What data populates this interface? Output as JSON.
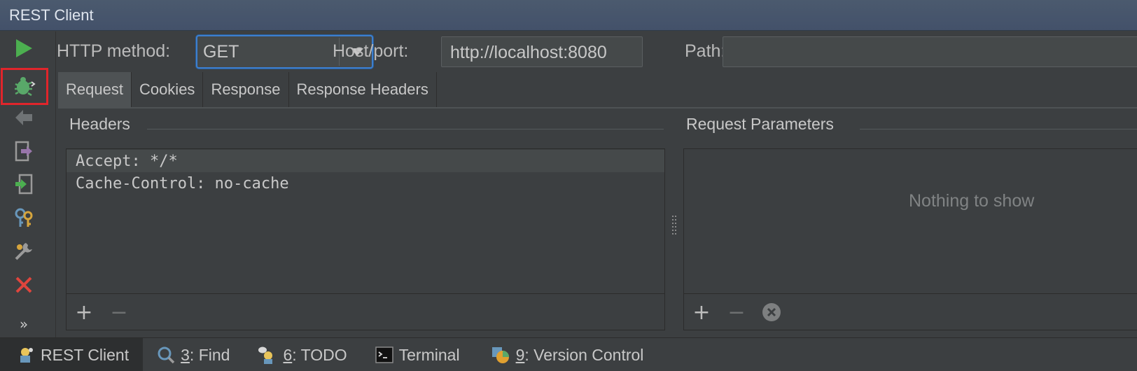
{
  "window": {
    "title": "REST Client"
  },
  "toolbar": {
    "items": [
      {
        "icon": "run-icon"
      },
      {
        "icon": "debug-bug-icon",
        "highlighted": true
      },
      {
        "icon": "back-arrow-icon"
      },
      {
        "icon": "export-icon"
      },
      {
        "icon": "import-icon"
      },
      {
        "icon": "keys-icon"
      },
      {
        "icon": "settings-wrench-icon"
      },
      {
        "icon": "close-icon"
      }
    ],
    "more_label": "»"
  },
  "request": {
    "method_label": "HTTP method:",
    "method_value": "GET",
    "host_label": "Host/port:",
    "host_value": "http://localhost:8080",
    "path_label": "Path:",
    "path_value": ""
  },
  "tabs": [
    {
      "label": "Request",
      "active": true
    },
    {
      "label": "Cookies"
    },
    {
      "label": "Response"
    },
    {
      "label": "Response Headers"
    }
  ],
  "headers": {
    "title": "Headers",
    "rows": [
      "Accept: */*",
      "Cache-Control: no-cache"
    ],
    "add": "+",
    "remove": "−"
  },
  "params": {
    "title": "Request Parameters",
    "empty": "Nothing to show",
    "add": "+",
    "remove": "−"
  },
  "statusbar": {
    "items": [
      {
        "label": "REST Client",
        "active": true
      },
      {
        "mnemonic": "3",
        "label": ": Find"
      },
      {
        "mnemonic": "6",
        "label": ": TODO"
      },
      {
        "label": "Terminal"
      },
      {
        "mnemonic": "9",
        "label": ": Version Control"
      }
    ]
  },
  "colors": {
    "accent": "#3d7fcf",
    "highlight": "#e0252b",
    "background": "#3c3f41"
  }
}
